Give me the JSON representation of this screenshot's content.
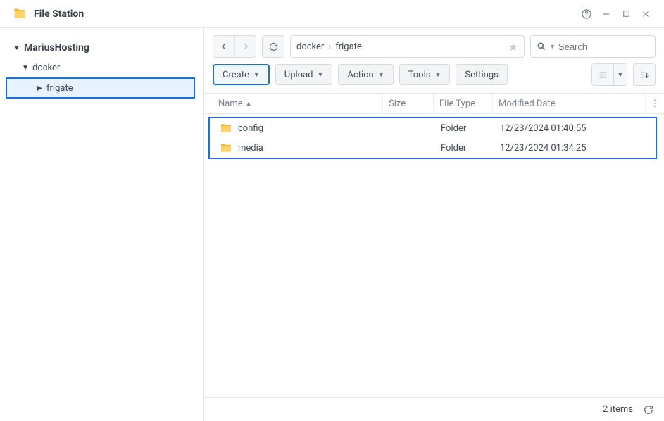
{
  "window": {
    "title": "File Station"
  },
  "tree": {
    "root": "MariusHosting",
    "level1": "docker",
    "level2": "frigate"
  },
  "breadcrumb": {
    "part1": "docker",
    "part2": "frigate"
  },
  "search": {
    "placeholder": "Search"
  },
  "toolbar": {
    "create": "Create",
    "upload": "Upload",
    "action": "Action",
    "tools": "Tools",
    "settings": "Settings"
  },
  "columns": {
    "name": "Name",
    "size": "Size",
    "type": "File Type",
    "date": "Modified Date"
  },
  "rows": [
    {
      "name": "config",
      "size": "",
      "type": "Folder",
      "date": "12/23/2024 01:40:55"
    },
    {
      "name": "media",
      "size": "",
      "type": "Folder",
      "date": "12/23/2024 01:34:25"
    }
  ],
  "status": {
    "count": "2 items"
  }
}
